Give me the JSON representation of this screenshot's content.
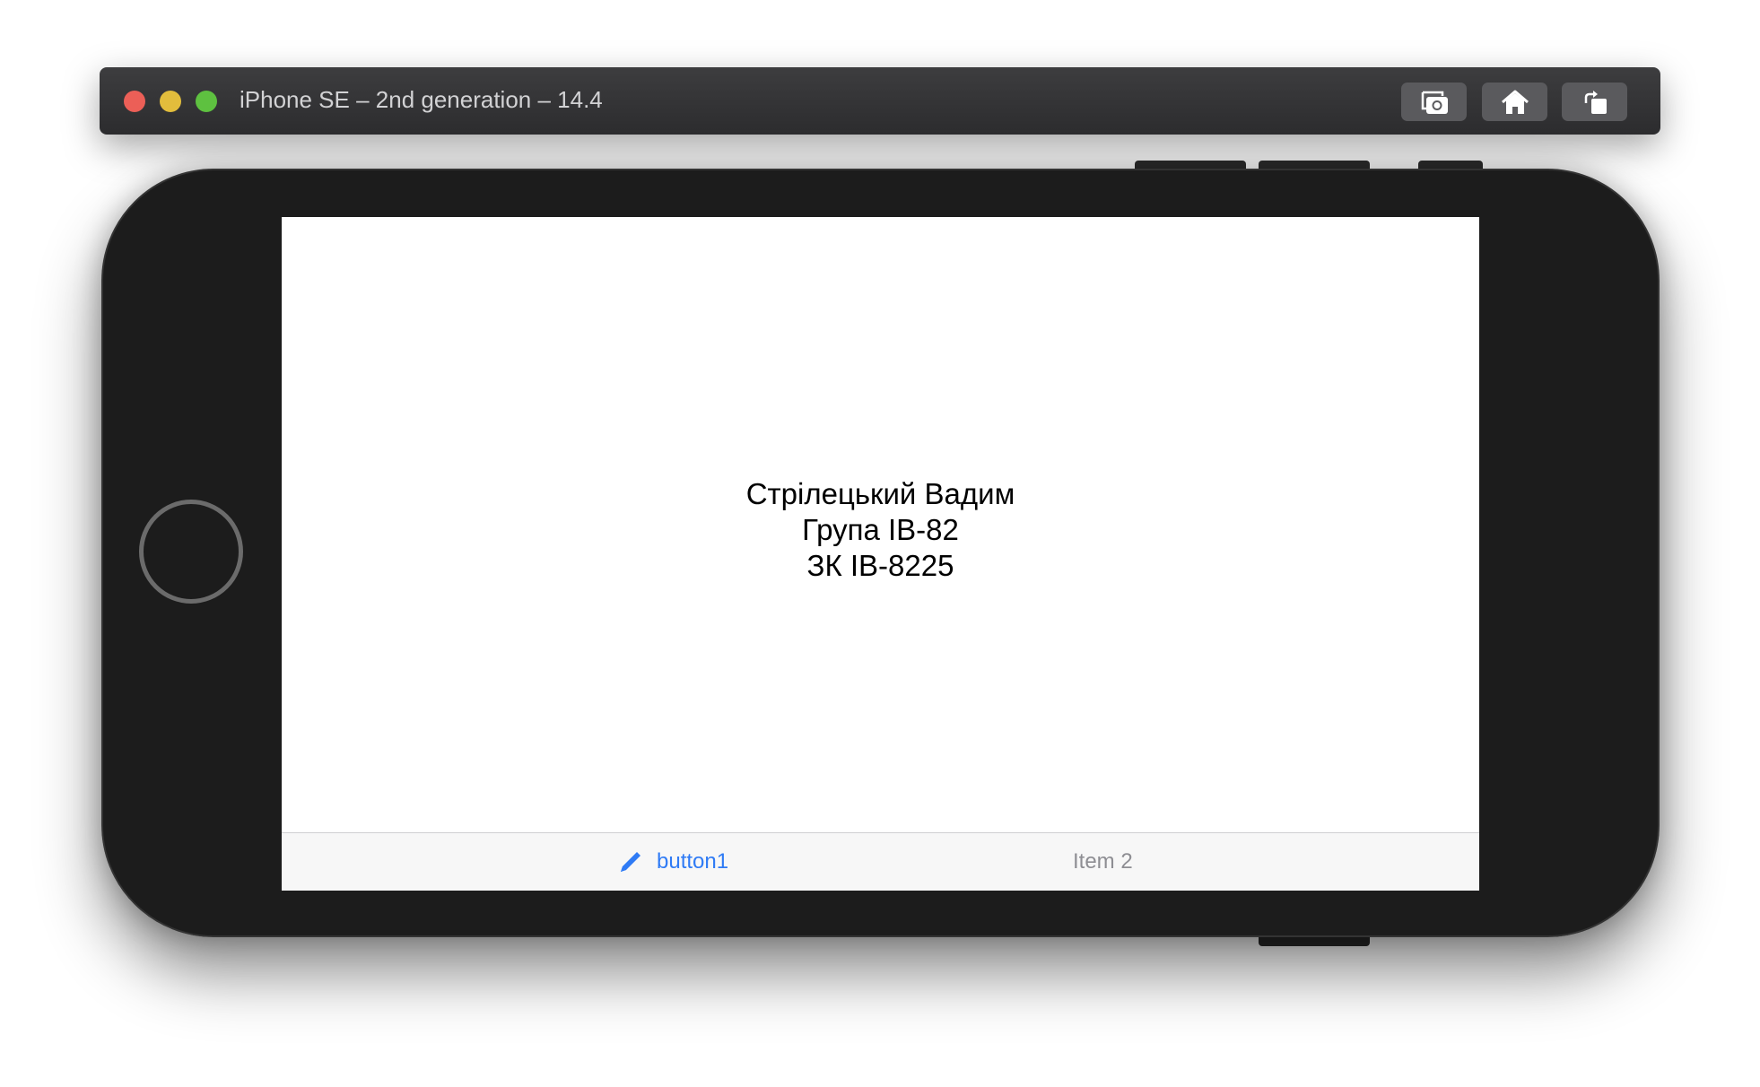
{
  "window": {
    "title": "iPhone SE – 2nd generation – 14.4",
    "colors": {
      "close": "#ec5f57",
      "minimize": "#e2bd3c",
      "zoom": "#5ec140"
    },
    "toolbar": [
      {
        "icon": "screenshot-icon"
      },
      {
        "icon": "home-icon"
      },
      {
        "icon": "rotate-icon"
      }
    ]
  },
  "screen": {
    "lines": [
      "Стрілецький Вадим",
      "Група ІВ-82",
      "ЗК ІВ-8225"
    ]
  },
  "tabbar": {
    "items": [
      {
        "label": "button1",
        "icon": "pencil-icon",
        "selected": true,
        "color": "#2f7bf5"
      },
      {
        "label": "Item 2",
        "selected": false,
        "color": "#8e8e93"
      }
    ]
  }
}
